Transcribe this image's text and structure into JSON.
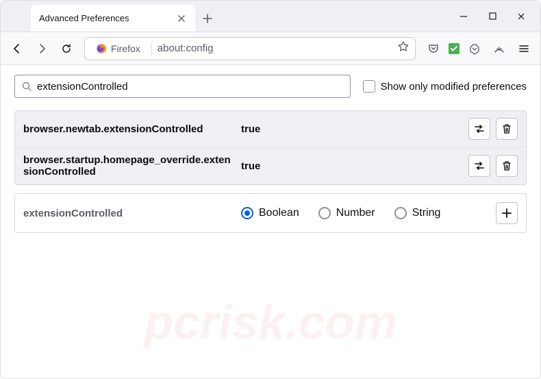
{
  "titlebar": {
    "tab_title": "Advanced Preferences"
  },
  "addressbar": {
    "identity": "Firefox",
    "url": "about:config"
  },
  "search": {
    "value": "extensionControlled",
    "checkbox_label": "Show only modified preferences"
  },
  "prefs": [
    {
      "name": "browser.newtab.extensionControlled",
      "value": "true"
    },
    {
      "name": "browser.startup.homepage_override.extensionControlled",
      "value": "true"
    }
  ],
  "add": {
    "name": "extensionControlled",
    "types": [
      "Boolean",
      "Number",
      "String"
    ],
    "selected": "Boolean"
  }
}
